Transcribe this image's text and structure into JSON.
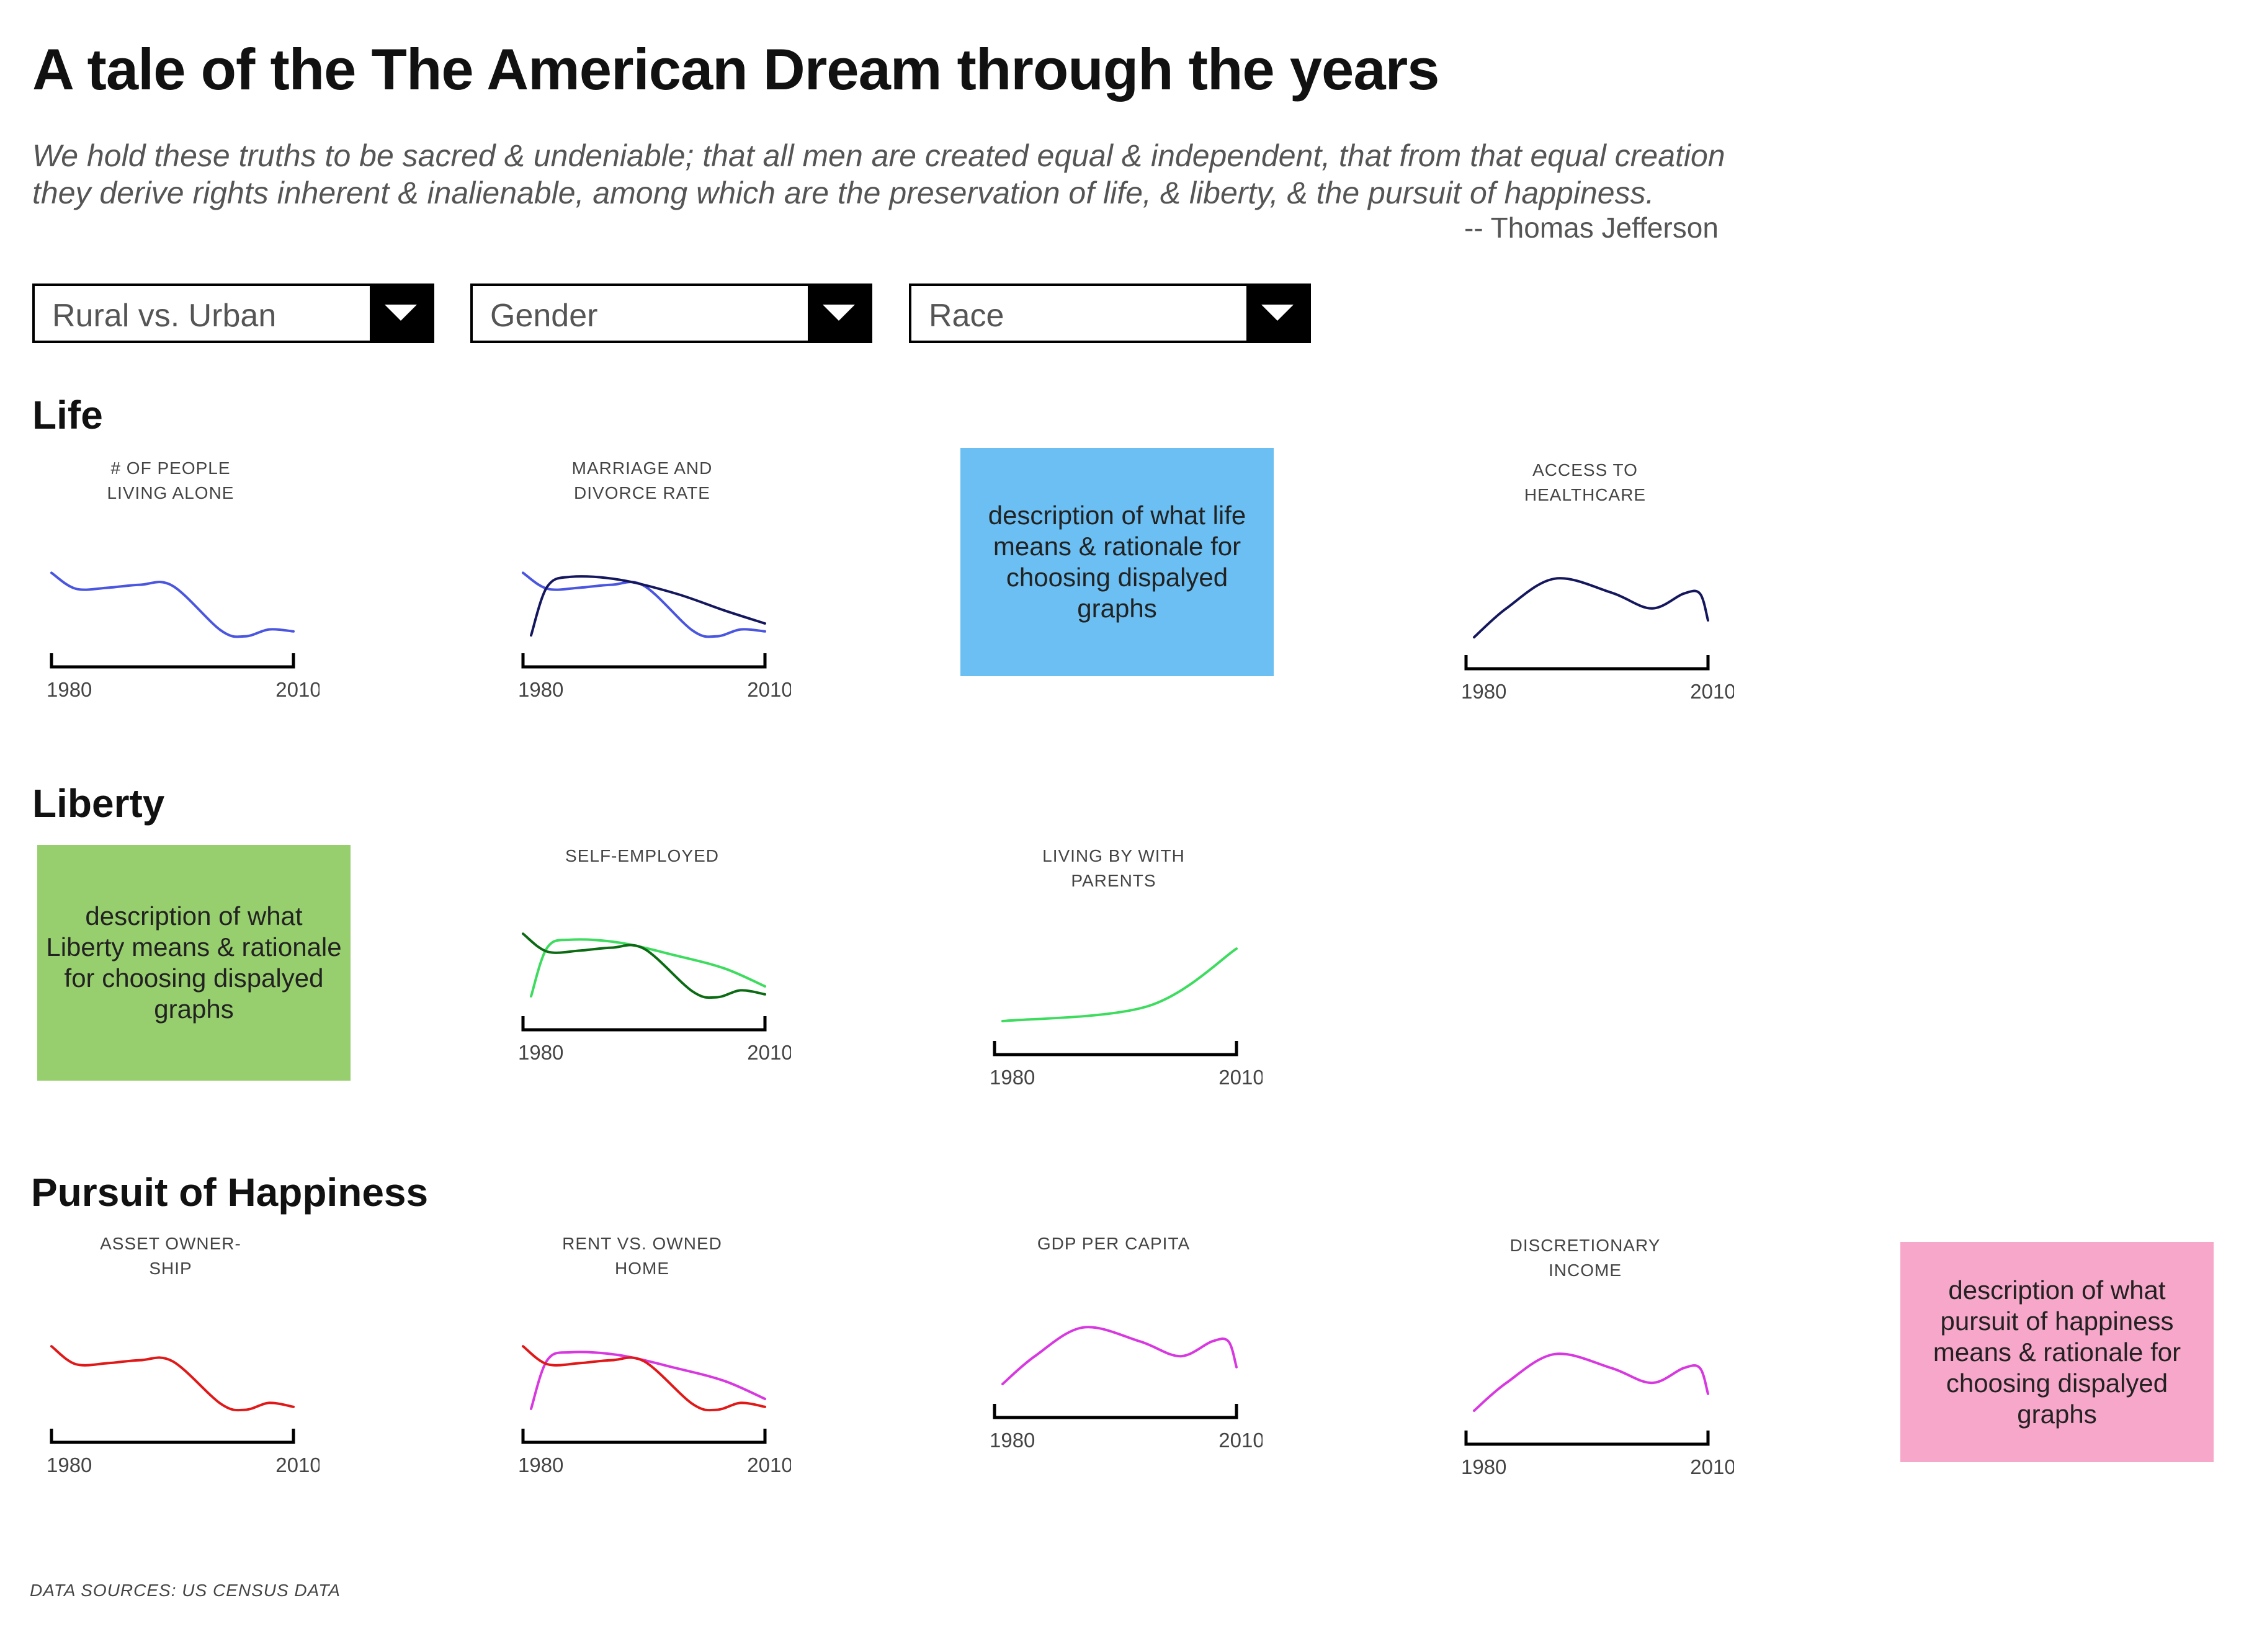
{
  "header": {
    "title": "A tale of the The American Dream through the years",
    "quote_line_1": "We hold these truths to be sacred & undeniable; that all men are created equal & independent, that from that equal creation",
    "quote_line_2": "they derive rights inherent & inalienable, among which are the preservation of life, & liberty, & the pursuit of happiness.",
    "attribution": "-- Thomas Jefferson"
  },
  "filters": [
    {
      "label": "Rural vs. Urban"
    },
    {
      "label": "Gender"
    },
    {
      "label": "Race"
    }
  ],
  "sections": {
    "life": {
      "title": "Life",
      "description": "description of what life means & rationale for choosing dispalyed graphs",
      "description_color": "#6bbff2"
    },
    "liberty": {
      "title": "Liberty",
      "description": "description of what Liberty means & rationale for choosing dispalyed graphs",
      "description_color": "#98cf6e"
    },
    "happiness": {
      "title": "Pursuit of Happiness",
      "description": "description of what pursuit of happiness means & rationale for choosing dispalyed graphs",
      "description_color": "#f7a7c9"
    }
  },
  "colors": {
    "blue": "#4a55e0",
    "navy": "#15175e",
    "light_green": "#3ddc5f",
    "dark_green": "#0a6b12",
    "red": "#e01818",
    "magenta": "#d838e0"
  },
  "chart_data": [
    {
      "type": "line",
      "title_line_1": "# OF PEOPLE",
      "title_line_2": "LIVING ALONE",
      "x_start": "1980",
      "x_end": "2010",
      "series": [
        {
          "color": "#4a55e0",
          "x": [
            1980,
            1983,
            1987,
            1991,
            1995,
            2001,
            2004,
            2007,
            2010
          ],
          "y": [
            0.76,
            0.6,
            0.61,
            0.64,
            0.63,
            0.18,
            0.12,
            0.19,
            0.17
          ]
        }
      ]
    },
    {
      "type": "line",
      "title_line_1": "MARRIAGE AND",
      "title_line_2": "DIVORCE RATE",
      "x_start": "1980",
      "x_end": "2010",
      "series": [
        {
          "color": "#4a55e0",
          "x": [
            1980,
            1983,
            1987,
            1991,
            1995,
            2001,
            2004,
            2007,
            2010
          ],
          "y": [
            0.76,
            0.6,
            0.61,
            0.64,
            0.63,
            0.18,
            0.12,
            0.19,
            0.17
          ]
        },
        {
          "color": "#15175e",
          "x": [
            1981,
            1983,
            1986,
            1992,
            1999,
            2005,
            2010
          ],
          "y": [
            0.13,
            0.62,
            0.72,
            0.69,
            0.55,
            0.38,
            0.25
          ]
        }
      ]
    },
    {
      "type": "line",
      "title_line_1": "ACCESS TO",
      "title_line_2": "HEALTHCARE",
      "x_start": "1980",
      "x_end": "2010",
      "series": [
        {
          "color": "#15175e",
          "x": [
            1981,
            1985,
            1991,
            1998,
            2003,
            2007,
            2009,
            2010
          ],
          "y": [
            0.13,
            0.42,
            0.72,
            0.58,
            0.42,
            0.57,
            0.57,
            0.3
          ]
        }
      ]
    },
    {
      "type": "line",
      "title_line_1": "SELF-EMPLOYED",
      "title_line_2": "",
      "x_start": "1980",
      "x_end": "2010",
      "series": [
        {
          "color": "#3ddc5f",
          "x": [
            1981,
            1983,
            1986,
            1992,
            1999,
            2005,
            2010
          ],
          "y": [
            0.15,
            0.64,
            0.72,
            0.69,
            0.56,
            0.43,
            0.25
          ]
        },
        {
          "color": "#0a6b12",
          "x": [
            1980,
            1983,
            1987,
            1991,
            1995,
            2001,
            2004,
            2007,
            2010
          ],
          "y": [
            0.78,
            0.6,
            0.61,
            0.64,
            0.63,
            0.2,
            0.14,
            0.21,
            0.17
          ]
        }
      ]
    },
    {
      "type": "line",
      "title_line_1": "LIVING BY WITH",
      "title_line_2": "PARENTS",
      "x_start": "1980",
      "x_end": "2010",
      "series": [
        {
          "color": "#3ddc5f",
          "x": [
            1981,
            1999,
            2010
          ],
          "y": [
            0.15,
            0.3,
            0.88
          ]
        }
      ]
    },
    {
      "type": "line",
      "title_line_1": "ASSET OWNER-",
      "title_line_2": "SHIP",
      "x_start": "1980",
      "x_end": "2010",
      "series": [
        {
          "color": "#e01818",
          "x": [
            1980,
            1983,
            1987,
            1991,
            1995,
            2001,
            2004,
            2007,
            2010
          ],
          "y": [
            0.78,
            0.6,
            0.61,
            0.64,
            0.63,
            0.2,
            0.14,
            0.21,
            0.17
          ]
        }
      ]
    },
    {
      "type": "line",
      "title_line_1": "RENT VS. OWNED",
      "title_line_2": "HOME",
      "x_start": "1980",
      "x_end": "2010",
      "series": [
        {
          "color": "#d838e0",
          "x": [
            1981,
            1983,
            1986,
            1992,
            1999,
            2005,
            2010
          ],
          "y": [
            0.15,
            0.64,
            0.72,
            0.69,
            0.56,
            0.43,
            0.25
          ]
        },
        {
          "color": "#e01818",
          "x": [
            1980,
            1983,
            1987,
            1991,
            1995,
            2001,
            2004,
            2007,
            2010
          ],
          "y": [
            0.78,
            0.6,
            0.61,
            0.64,
            0.63,
            0.2,
            0.14,
            0.21,
            0.17
          ]
        }
      ]
    },
    {
      "type": "line",
      "title_line_1": "GDP PER CAPITA",
      "title_line_2": "",
      "x_start": "1980",
      "x_end": "2010",
      "series": [
        {
          "color": "#d838e0",
          "x": [
            1981,
            1985,
            1991,
            1998,
            2003,
            2007,
            2009,
            2010
          ],
          "y": [
            0.15,
            0.43,
            0.72,
            0.58,
            0.43,
            0.58,
            0.58,
            0.32
          ]
        }
      ]
    },
    {
      "type": "line",
      "title_line_1": "DISCRETIONARY",
      "title_line_2": "INCOME",
      "x_start": "1980",
      "x_end": "2010",
      "series": [
        {
          "color": "#d838e0",
          "x": [
            1981,
            1985,
            1991,
            1998,
            2003,
            2007,
            2009,
            2010
          ],
          "y": [
            0.15,
            0.43,
            0.72,
            0.58,
            0.43,
            0.58,
            0.58,
            0.32
          ]
        }
      ]
    }
  ],
  "footer": {
    "sources": "DATA SOURCES: US CENSUS DATA"
  }
}
